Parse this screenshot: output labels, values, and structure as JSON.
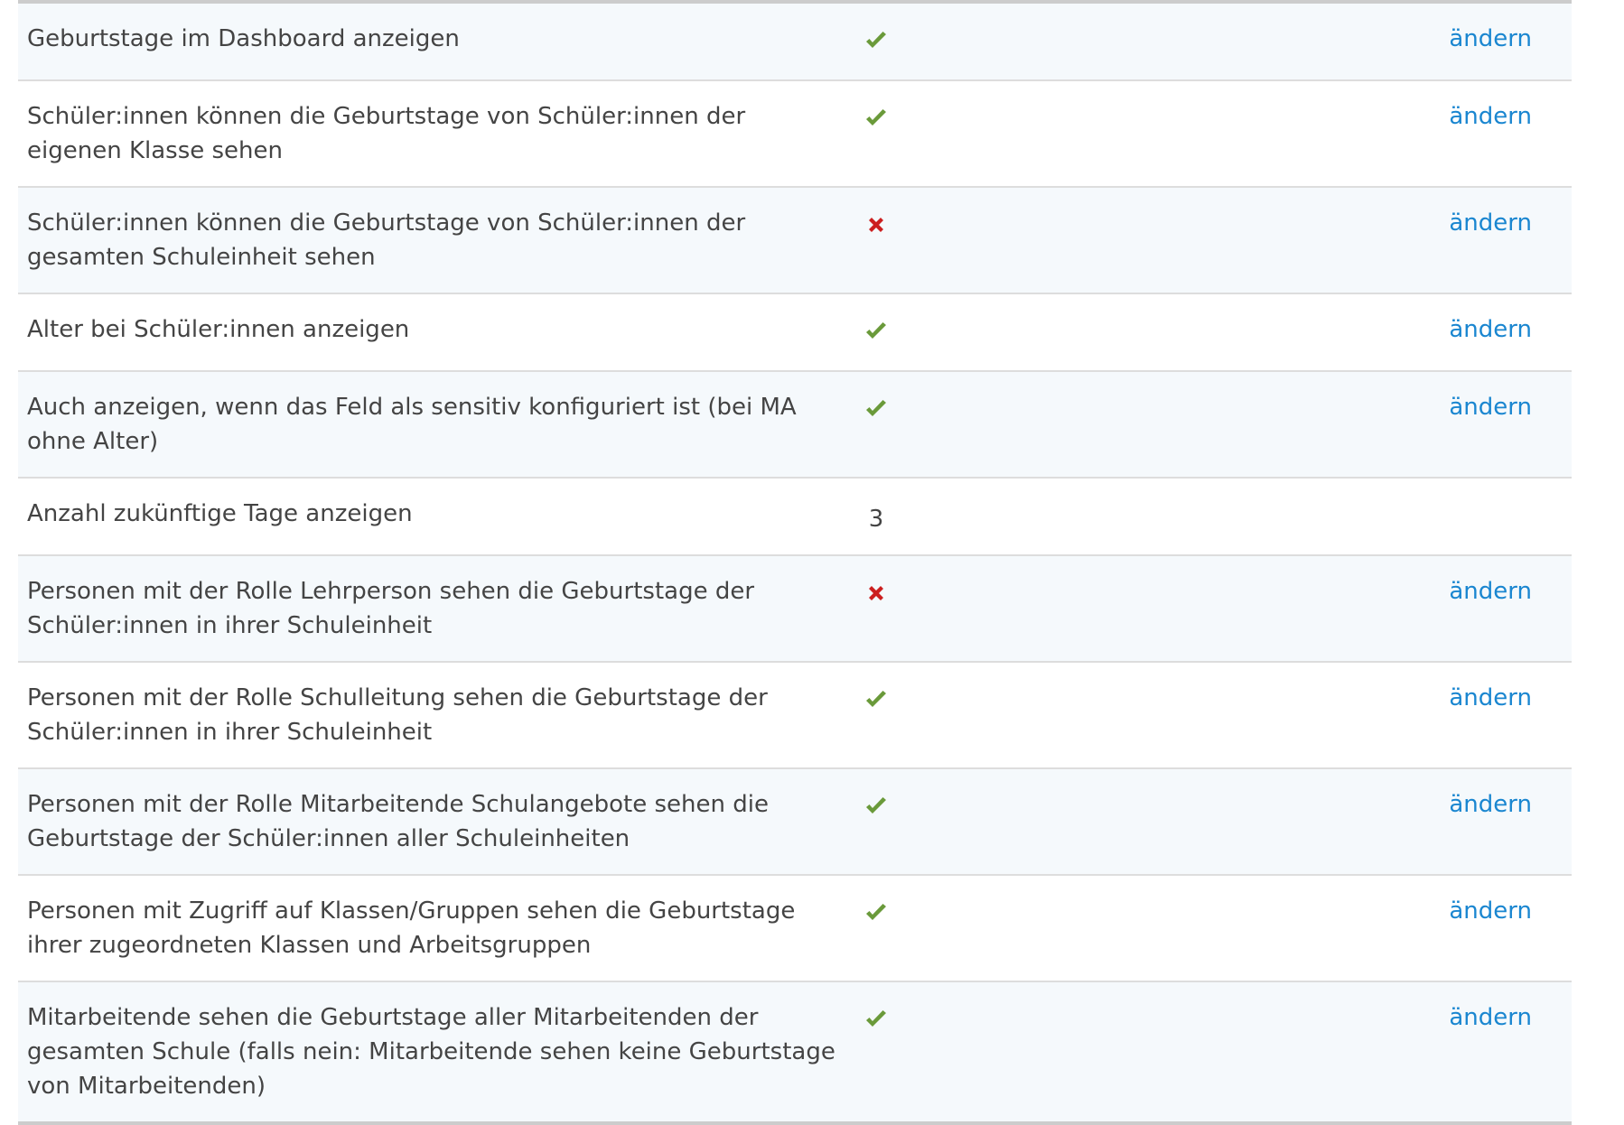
{
  "settings": {
    "edit_label": "ändern",
    "rows": [
      {
        "label": "Geburtstage im Dashboard anzeigen",
        "value": "check",
        "editable": true
      },
      {
        "label": "Schüler:innen können die Geburtstage von Schüler:innen der eigenen Klasse sehen",
        "value": "check",
        "editable": true
      },
      {
        "label": "Schüler:innen können die Geburtstage von Schüler:innen der gesamten Schuleinheit sehen",
        "value": "cross",
        "editable": true
      },
      {
        "label": "Alter bei Schüler:innen anzeigen",
        "value": "check",
        "editable": true
      },
      {
        "label": "Auch anzeigen, wenn das Feld als sensitiv konfiguriert ist (bei MA ohne Alter)",
        "value": "check",
        "editable": true
      },
      {
        "label": "Anzahl zukünftige Tage anzeigen",
        "value": "3",
        "editable": false
      },
      {
        "label": "Personen mit der Rolle Lehrperson sehen die Geburtstage der Schüler:innen in ihrer Schuleinheit",
        "value": "cross",
        "editable": true
      },
      {
        "label": "Personen mit der Rolle Schulleitung sehen die Geburtstage der Schüler:innen in ihrer Schuleinheit",
        "value": "check",
        "editable": true
      },
      {
        "label": "Personen mit der Rolle Mitarbeitende Schulangebote sehen die Geburtstage der Schüler:innen aller Schuleinheiten",
        "value": "check",
        "editable": true
      },
      {
        "label": "Personen mit Zugriff auf Klassen/Gruppen sehen die Geburtstage ihrer zugeordneten Klassen und Arbeitsgruppen",
        "value": "check",
        "editable": true
      },
      {
        "label": "Mitarbeitende sehen die Geburtstage aller Mitarbeitenden der gesamten Schule (falls nein: Mitarbeitende sehen keine Geburtstage von Mitarbeitenden)",
        "value": "check",
        "editable": true
      }
    ]
  },
  "colors": {
    "check": "#6a9a3a",
    "cross": "#cc1f1f",
    "link": "#1a86d0",
    "row_alt": "#f5f9fc",
    "divider": "#dddddd"
  },
  "icons": {
    "check": "check-icon",
    "cross": "cross-icon"
  }
}
